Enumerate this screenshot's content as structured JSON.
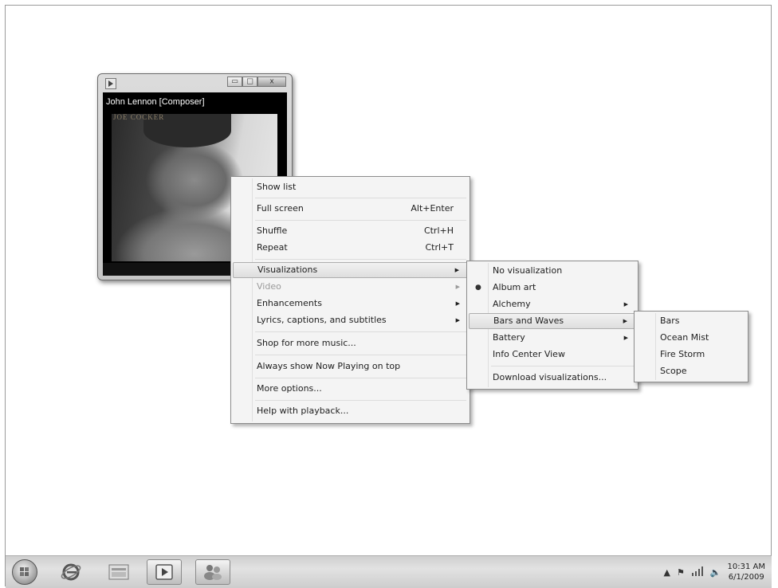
{
  "now_playing": {
    "artist_label": "John Lennon [Composer]",
    "album_art_title": "JOE COCKER",
    "window_buttons": {
      "minimize": "▭",
      "maximize": "□",
      "close": "x"
    }
  },
  "context_menu": {
    "items": [
      {
        "label": "Show list",
        "shortcut": ""
      },
      {
        "label": "Full screen",
        "shortcut": "Alt+Enter"
      },
      {
        "label": "Shuffle",
        "shortcut": "Ctrl+H"
      },
      {
        "label": "Repeat",
        "shortcut": "Ctrl+T"
      },
      {
        "label": "Visualizations",
        "shortcut": ""
      },
      {
        "label": "Video",
        "shortcut": ""
      },
      {
        "label": "Enhancements",
        "shortcut": ""
      },
      {
        "label": "Lyrics, captions, and subtitles",
        "shortcut": ""
      },
      {
        "label": "Shop for more music...",
        "shortcut": ""
      },
      {
        "label": "Always show Now Playing on top",
        "shortcut": ""
      },
      {
        "label": "More options...",
        "shortcut": ""
      },
      {
        "label": "Help with playback...",
        "shortcut": ""
      }
    ]
  },
  "visualizations_menu": {
    "items": [
      {
        "label": "No visualization"
      },
      {
        "label": "Album art",
        "selected": true
      },
      {
        "label": "Alchemy"
      },
      {
        "label": "Bars and Waves"
      },
      {
        "label": "Battery"
      },
      {
        "label": "Info Center View"
      },
      {
        "label": "Download visualizations..."
      }
    ]
  },
  "bars_waves_menu": {
    "items": [
      {
        "label": "Bars"
      },
      {
        "label": "Ocean Mist"
      },
      {
        "label": "Fire Storm"
      },
      {
        "label": "Scope"
      }
    ]
  },
  "taskbar": {
    "icons": [
      "windows-start-icon",
      "internet-explorer-icon",
      "file-explorer-icon",
      "media-player-icon",
      "messenger-icon"
    ],
    "tray": {
      "time": "10:31 AM",
      "date": "6/1/2009"
    }
  }
}
